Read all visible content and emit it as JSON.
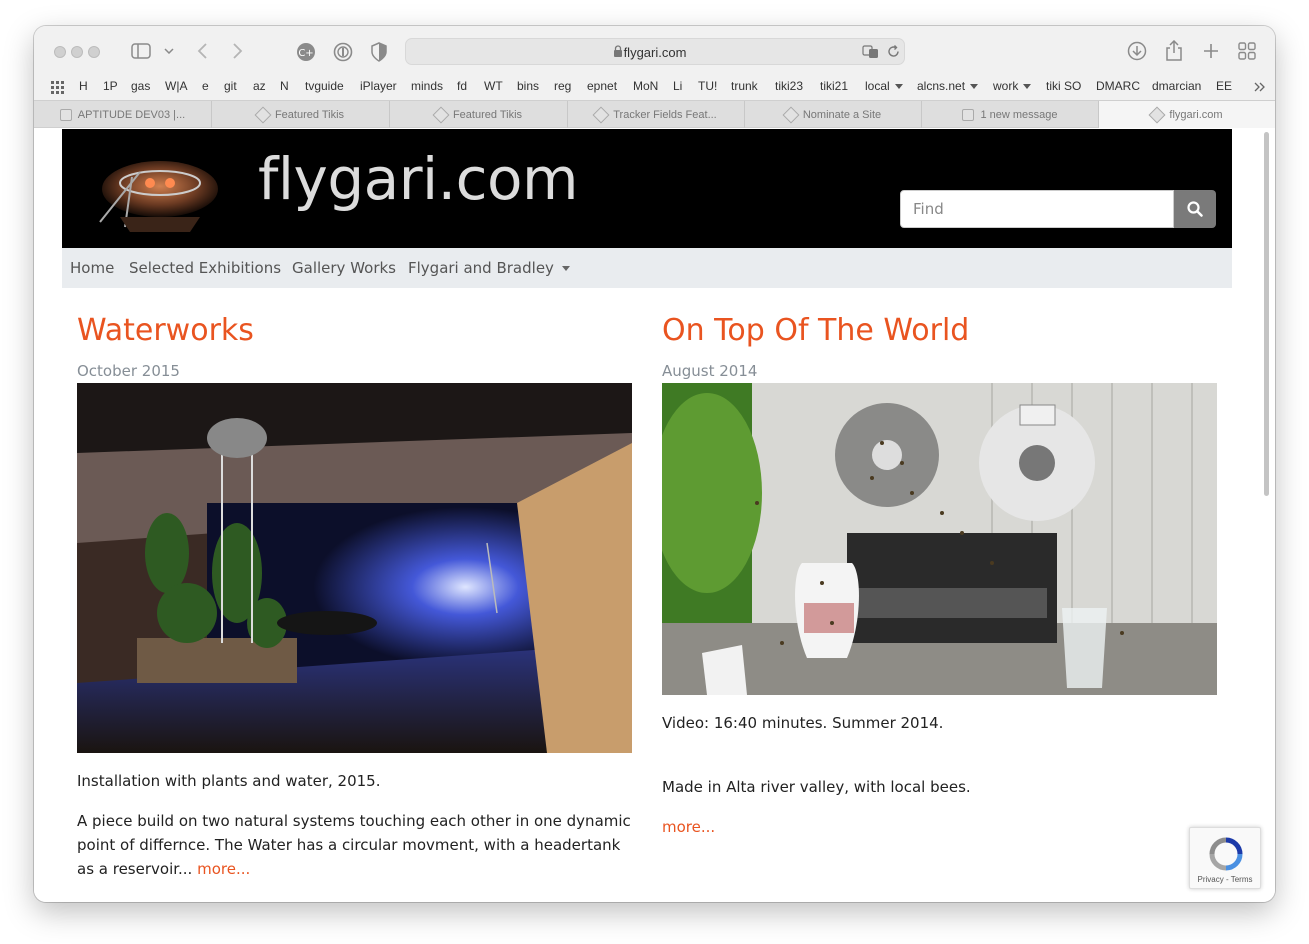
{
  "browser": {
    "address": "flygari.com",
    "bookmarks": [
      "H",
      "1P",
      "gas",
      "W|A",
      "e",
      "git",
      "az",
      "N",
      "tvguide",
      "iPlayer",
      "minds",
      "fd",
      "WT",
      "bins",
      "reg",
      "epnet",
      "MoN",
      "Li",
      "TU!",
      "trunk",
      "tiki23",
      "tiki21",
      "local",
      "alcns.net",
      "work",
      "tiki SO",
      "DMARC",
      "dmarcian",
      "EE"
    ],
    "tabs": [
      "APTITUDE DEV03 |...",
      "Featured Tikis",
      "Featured Tikis",
      "Tracker Fields Feat...",
      "Nominate a Site",
      "1 new message",
      "flygari.com"
    ]
  },
  "site": {
    "title": "flygari.com",
    "search_placeholder": "Find",
    "nav": [
      "Home",
      "Selected Exhibitions",
      "Gallery Works",
      "Flygari and Bradley"
    ]
  },
  "posts": [
    {
      "title": "Waterworks",
      "date": "October 2015",
      "paragraph1": "Installation with plants and water, 2015.",
      "paragraph2": "A piece build on two natural systems touching each other in one dynamic point of differnce. The Water has a circular movment, with a headertank as a reservoir...",
      "more": "more..."
    },
    {
      "title": "On Top Of The World",
      "date": "August 2014",
      "paragraph1": "Video: 16:40 minutes. Summer 2014.",
      "paragraph2": "Made in Alta river valley, with local bees.",
      "more": "more..."
    }
  ],
  "recaptcha": {
    "label": "Privacy - Terms"
  },
  "colors": {
    "accent": "#e95420",
    "header_bg": "#000000",
    "nav_bg": "#e9ecef"
  }
}
